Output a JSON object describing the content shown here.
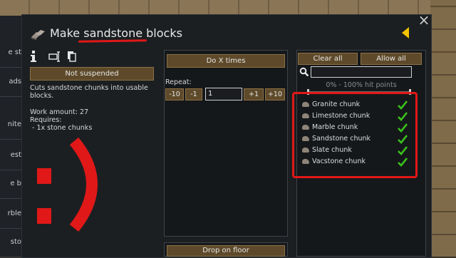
{
  "dialog": {
    "title": "Make sandstone blocks",
    "close_symbol": "×"
  },
  "background": {
    "left_tabs": [
      "e st",
      "ads",
      "nite",
      "est",
      "e b",
      "rble",
      "sto"
    ]
  },
  "left": {
    "suspend_button": "Not suspended",
    "description": "Cuts sandstone chunks into usable blocks.",
    "work_amount": "Work amount: 27",
    "requires_label": "Requires:",
    "requires_item": " - 1x stone chunks",
    "overlay_smiley": ":)",
    "icons": [
      "info-icon",
      "rename-icon",
      "copy-icon"
    ]
  },
  "middle": {
    "mode_button": "Do X times",
    "repeat_label": "Repeat:",
    "minus10": "-10",
    "minus1": "-1",
    "repeat_value": "1",
    "plus1": "+1",
    "plus10": "+10",
    "store_button": "Drop on floor"
  },
  "right": {
    "clear_all": "Clear all",
    "allow_all": "Allow all",
    "search_placeholder": "",
    "hp_range": "0% - 100% hit points",
    "items": [
      {
        "label": "Granite chunk",
        "allowed": true
      },
      {
        "label": "Limestone chunk",
        "allowed": true
      },
      {
        "label": "Marble chunk",
        "allowed": true
      },
      {
        "label": "Sandstone chunk",
        "allowed": true
      },
      {
        "label": "Slate chunk",
        "allowed": true
      },
      {
        "label": "Vacstone chunk",
        "allowed": true
      }
    ]
  },
  "colors": {
    "accent_red": "#e01818",
    "check_green": "#3ac21a",
    "button_brown": "#5e4a2a",
    "arrow_yellow": "#f0c400"
  }
}
